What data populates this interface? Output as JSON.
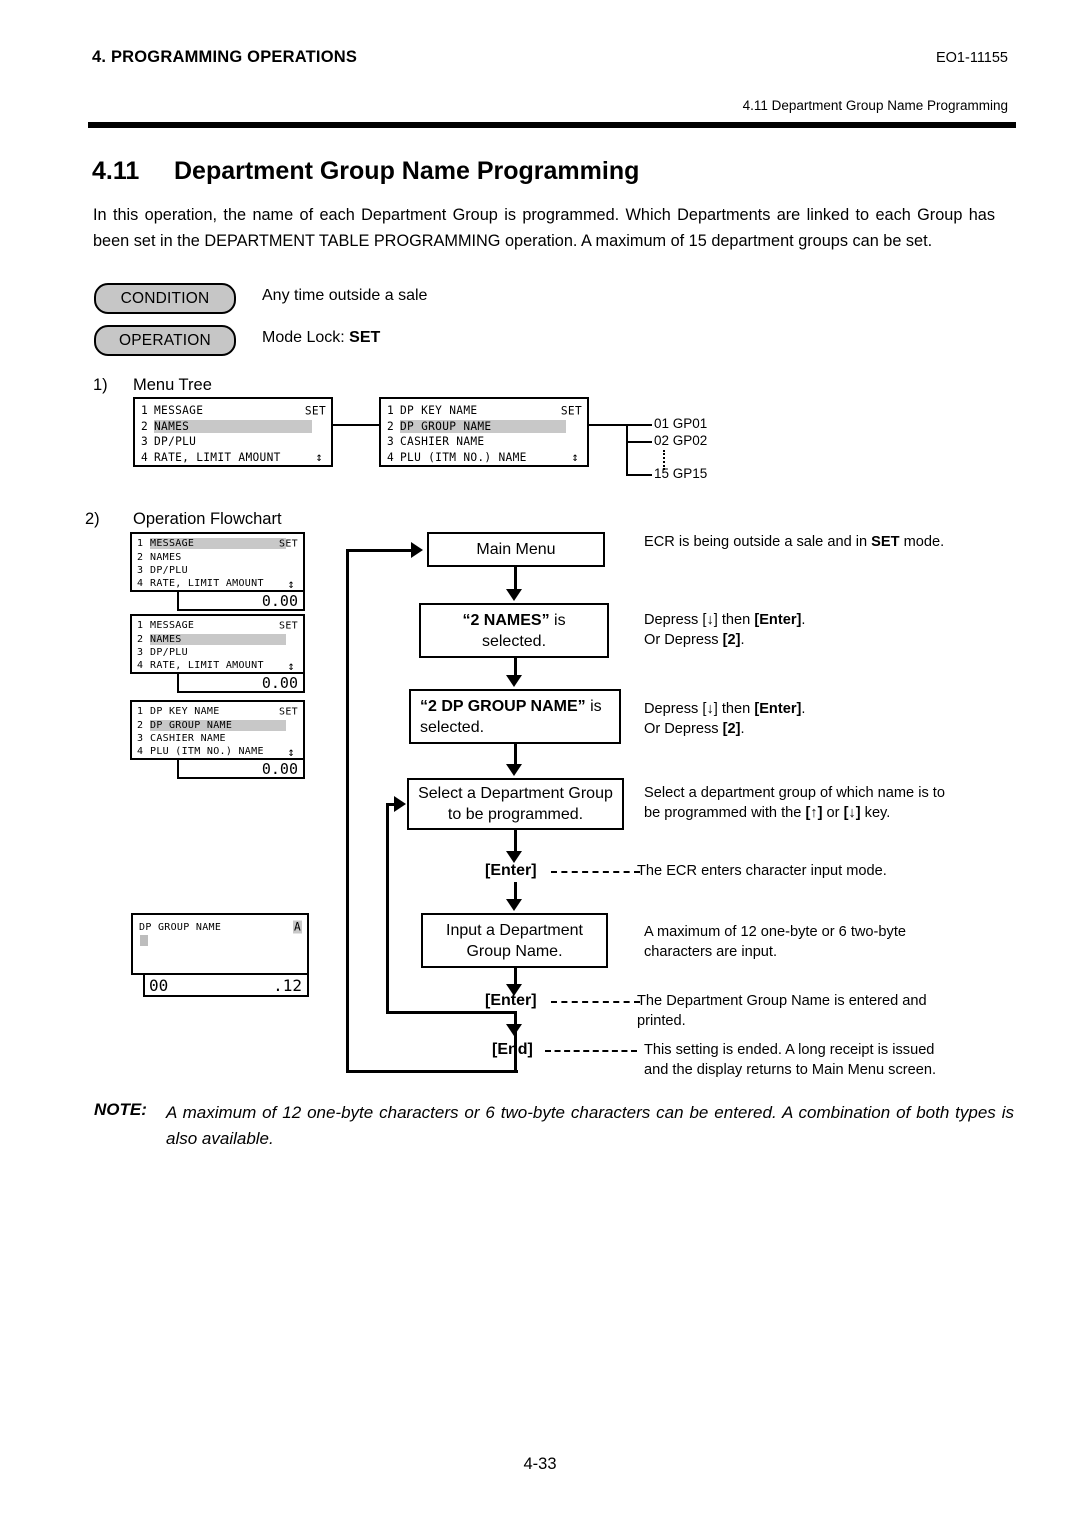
{
  "header": {
    "chapter": "4. PROGRAMMING OPERATIONS",
    "doc_code": "EO1-11155",
    "subtitle": "4.11 Department Group Name Programming"
  },
  "section": {
    "number": "4.11",
    "title": "Department Group Name Programming",
    "intro": "In this operation, the name of each Department Group is programmed.  Which Departments are linked to each Group has been set in the DEPARTMENT TABLE PROGRAMMING operation.  A maximum of 15 department groups can be set."
  },
  "condition": {
    "label": "CONDITION",
    "value": "Any time outside a sale"
  },
  "operation": {
    "label": "OPERATION",
    "value_prefix": "Mode Lock: ",
    "value_bold": "SET"
  },
  "steps": {
    "one_num": "1)",
    "one_label": "Menu Tree",
    "two_num": "2)",
    "two_label": "Operation Flowchart"
  },
  "menu_tree": {
    "panel1": {
      "rows": [
        {
          "idx": "1",
          "text": "MESSAGE",
          "highlight": false
        },
        {
          "idx": "2",
          "text": "NAMES",
          "highlight": true
        },
        {
          "idx": "3",
          "text": "DP/PLU",
          "highlight": false
        },
        {
          "idx": "4",
          "text": "RATE, LIMIT AMOUNT",
          "highlight": false
        }
      ],
      "mode": "SET",
      "updown": "↕"
    },
    "panel2": {
      "rows": [
        {
          "idx": "1",
          "text": "DP KEY NAME",
          "highlight": false
        },
        {
          "idx": "2",
          "text": "DP GROUP NAME",
          "highlight": true
        },
        {
          "idx": "3",
          "text": "CASHIER NAME",
          "highlight": false
        },
        {
          "idx": "4",
          "text": "PLU (ITM NO.) NAME",
          "highlight": false
        }
      ],
      "mode": "SET",
      "updown": "↕"
    },
    "groups": [
      {
        "label": "01 GP01"
      },
      {
        "label": "02 GP02"
      },
      {
        "label": "15 GP15"
      }
    ]
  },
  "flowchart_lcds": {
    "lcd1": {
      "rows": [
        {
          "idx": "1",
          "text": "MESSAGE",
          "highlight": true
        },
        {
          "idx": "2",
          "text": "NAMES",
          "highlight": false
        },
        {
          "idx": "3",
          "text": "DP/PLU",
          "highlight": false
        },
        {
          "idx": "4",
          "text": "RATE, LIMIT AMOUNT",
          "highlight": false
        }
      ],
      "mode": "SET",
      "updown": "↕",
      "amount": "0.00"
    },
    "lcd2": {
      "rows": [
        {
          "idx": "1",
          "text": "MESSAGE",
          "highlight": false
        },
        {
          "idx": "2",
          "text": "NAMES",
          "highlight": true
        },
        {
          "idx": "3",
          "text": "DP/PLU",
          "highlight": false
        },
        {
          "idx": "4",
          "text": "RATE, LIMIT AMOUNT",
          "highlight": false
        }
      ],
      "mode": "SET",
      "updown": "↕",
      "amount": "0.00"
    },
    "lcd3": {
      "rows": [
        {
          "idx": "1",
          "text": "DP KEY NAME",
          "highlight": false
        },
        {
          "idx": "2",
          "text": "DP GROUP NAME",
          "highlight": true
        },
        {
          "idx": "3",
          "text": "CASHIER NAME",
          "highlight": false
        },
        {
          "idx": "4",
          "text": "PLU (ITM NO.) NAME",
          "highlight": false
        }
      ],
      "mode": "SET",
      "updown": "↕",
      "amount": "0.00"
    },
    "lcd4": {
      "title": "DP GROUP NAME",
      "indicator": "A",
      "bar_left": "00",
      "bar_right": ".12"
    }
  },
  "flow": {
    "box_main": "Main Menu",
    "box_names_bold": "“2 NAMES”",
    "box_names_rest": " is",
    "box_names_line2": "selected.",
    "box_dpgroup_bold": "“2 DP GROUP NAME”",
    "box_dpgroup_rest": " is",
    "box_dpgroup_line2": "selected.",
    "box_select_line1": "Select a Department Group",
    "box_select_line2": "to be programmed.",
    "box_input_line1": "Input a Department",
    "box_input_line2": "Group Name.",
    "key_enter_1": "[Enter]",
    "key_enter_2": "[Enter]",
    "key_end": "[End]"
  },
  "annotations": {
    "a1_pre": "ECR is being outside a sale and in ",
    "a1_bold": "SET",
    "a1_post": " mode.",
    "a2_l1_pre": "Depress [↓] then ",
    "a2_l1_bold": "[Enter]",
    "a2_l1_post": ".",
    "a2_l2_pre": "Or Depress ",
    "a2_l2_bold": "[2]",
    "a2_l2_post": ".",
    "a3_l1_pre": "Depress [↓] then ",
    "a3_l1_bold": "[Enter]",
    "a3_l1_post": ".",
    "a3_l2_pre": "Or Depress ",
    "a3_l2_bold": "[2]",
    "a3_l2_post": ".",
    "a4_l1": "Select a department group of which name is to",
    "a4_l2_pre": "be programmed with the ",
    "a4_l2_b1": "[↑]",
    "a4_l2_mid": " or ",
    "a4_l2_b2": "[↓]",
    "a4_l2_post": " key.",
    "a5": "The ECR enters character input mode.",
    "a6_l1": "A  maximum  of  12  one-byte  or  6  two-byte",
    "a6_l2": "characters are input.",
    "a7_l1": "The Department Group Name is entered and",
    "a7_l2": "printed.",
    "a8_l1": "This  setting  is  ended.   A  long  receipt  is  issued",
    "a8_l2": "and the display returns to Main Menu screen."
  },
  "note": {
    "label": "NOTE:",
    "text": "A maximum of 12 one-byte characters or 6 two-byte characters can be entered.  A combination of both types is also available."
  },
  "footer": {
    "page": "4-33"
  }
}
